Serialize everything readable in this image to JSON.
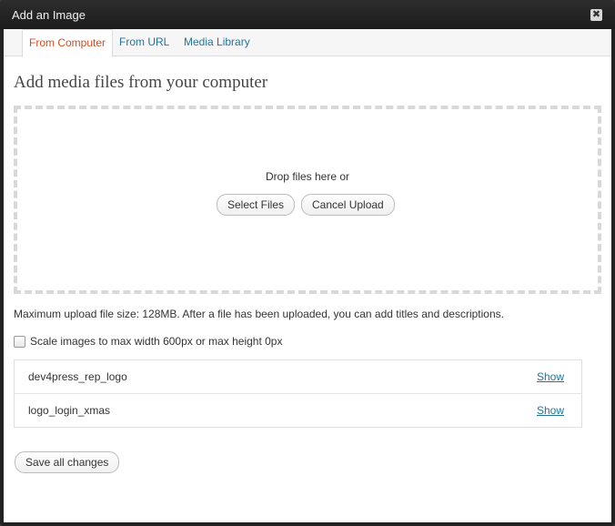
{
  "window": {
    "title": "Add an Image",
    "close_glyph": "✖"
  },
  "tabs": [
    {
      "label": "From Computer",
      "active": true
    },
    {
      "label": "From URL",
      "active": false
    },
    {
      "label": "Media Library",
      "active": false
    }
  ],
  "main": {
    "heading": "Add media files from your computer",
    "dropzone": {
      "text": "Drop files here or",
      "select_label": "Select Files",
      "cancel_label": "Cancel Upload"
    },
    "max_upload_info": "Maximum upload file size: 128MB. After a file has been uploaded, you can add titles and descriptions.",
    "scale_label": "Scale images to max width 600px or max height 0px",
    "scale_checked": false,
    "files": [
      {
        "name": "dev4press_rep_logo",
        "action": "Show"
      },
      {
        "name": "logo_login_xmas",
        "action": "Show"
      }
    ],
    "save_label": "Save all changes"
  },
  "colors": {
    "accent": "#d54e21",
    "link": "#21759b",
    "titlebar": "#222222"
  }
}
